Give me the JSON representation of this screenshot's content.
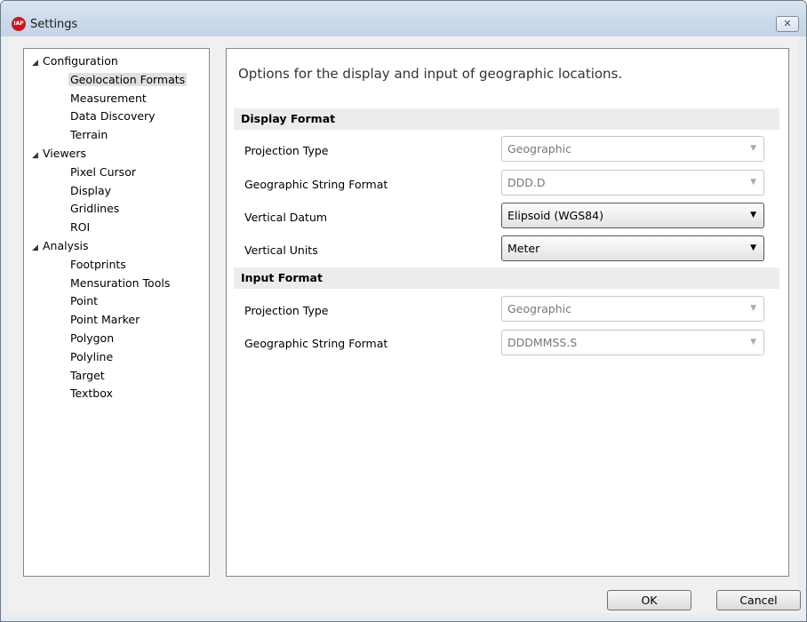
{
  "window": {
    "title": "Settings",
    "close_glyph": "✕",
    "app_icon_text": "IAP"
  },
  "tree": {
    "items": [
      {
        "label": "Configuration",
        "level": 0
      },
      {
        "label": "Geolocation Formats",
        "level": 1,
        "selected": true
      },
      {
        "label": "Measurement",
        "level": 1
      },
      {
        "label": "Data Discovery",
        "level": 1
      },
      {
        "label": "Terrain",
        "level": 1
      },
      {
        "label": "Viewers",
        "level": 0
      },
      {
        "label": "Pixel Cursor",
        "level": 1
      },
      {
        "label": "Display",
        "level": 1
      },
      {
        "label": "Gridlines",
        "level": 1
      },
      {
        "label": "ROI",
        "level": 1
      },
      {
        "label": "Analysis",
        "level": 0
      },
      {
        "label": "Footprints",
        "level": 1
      },
      {
        "label": "Mensuration Tools",
        "level": 1
      },
      {
        "label": "Point",
        "level": 1
      },
      {
        "label": "Point Marker",
        "level": 1
      },
      {
        "label": "Polygon",
        "level": 1
      },
      {
        "label": "Polyline",
        "level": 1
      },
      {
        "label": "Target",
        "level": 1
      },
      {
        "label": "Textbox",
        "level": 1
      }
    ]
  },
  "content": {
    "intro": "Options for the display and input of geographic locations.",
    "display_format": {
      "header": "Display Format",
      "projection_type": {
        "label": "Projection Type",
        "value": "Geographic"
      },
      "geo_string_format": {
        "label": "Geographic String Format",
        "value": "DDD.D"
      },
      "vertical_datum": {
        "label": "Vertical Datum",
        "value": "Elipsoid (WGS84)"
      },
      "vertical_units": {
        "label": "Vertical Units",
        "value": "Meter"
      }
    },
    "input_format": {
      "header": "Input Format",
      "projection_type": {
        "label": "Projection Type",
        "value": "Geographic"
      },
      "geo_string_format": {
        "label": "Geographic String Format",
        "value": "DDDMMSS.S"
      }
    }
  },
  "buttons": {
    "ok": "OK",
    "cancel": "Cancel"
  },
  "icons": {
    "caret": "▼",
    "tree_expanded": "◢"
  }
}
